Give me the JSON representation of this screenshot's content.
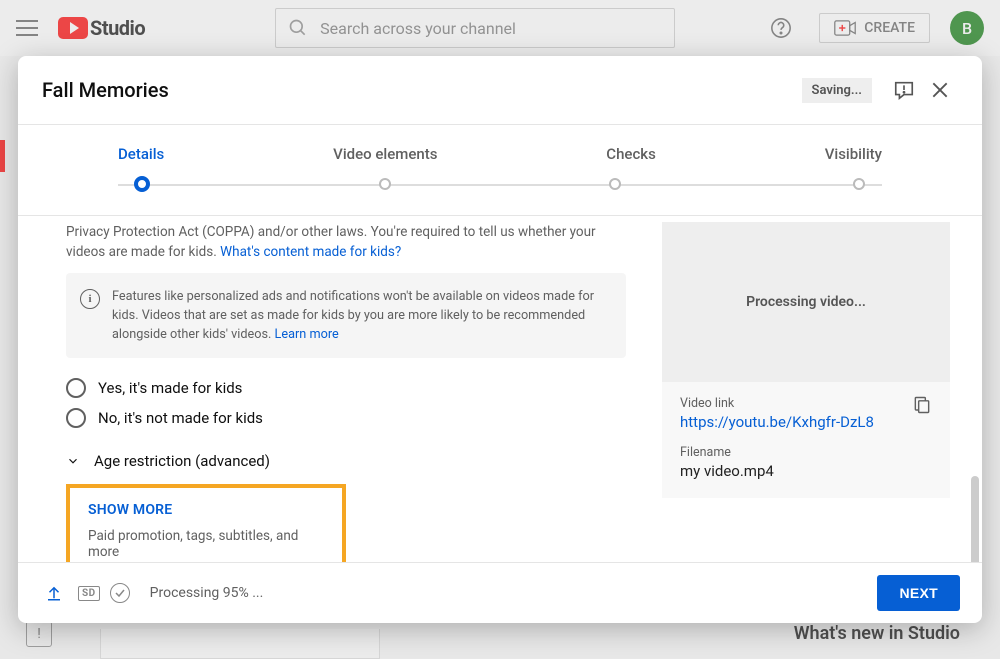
{
  "header": {
    "logo_text": "Studio",
    "search_placeholder": "Search across your channel",
    "create_label": "CREATE",
    "avatar_initial": "B"
  },
  "background": {
    "whats_new": "What's new in Studio"
  },
  "modal": {
    "title": "Fall Memories",
    "saving_label": "Saving...",
    "stepper": {
      "steps": [
        "Details",
        "Video elements",
        "Checks",
        "Visibility"
      ],
      "active_index": 0
    },
    "coppa_text": "Privacy Protection Act (COPPA) and/or other laws. You're required to tell us whether your videos are made for kids. ",
    "coppa_link": "What's content made for kids?",
    "feature_box": "Features like personalized ads and notifications won't be available on videos made for kids. Videos that are set as made for kids by you are more likely to be recommended alongside other kids' videos. ",
    "feature_learn_more": "Learn more",
    "radio_yes": "Yes, it's made for kids",
    "radio_no": "No, it's not made for kids",
    "age_restriction": "Age restriction (advanced)",
    "show_more": "SHOW MORE",
    "show_more_desc": "Paid promotion, tags, subtitles, and more",
    "preview": {
      "status": "Processing video...",
      "video_link_label": "Video link",
      "video_link": "https://youtu.be/Kxhgfr-DzL8",
      "filename_label": "Filename",
      "filename": "my video.mp4"
    },
    "footer": {
      "sd": "SD",
      "processing": "Processing 95% ...",
      "next": "NEXT"
    }
  }
}
